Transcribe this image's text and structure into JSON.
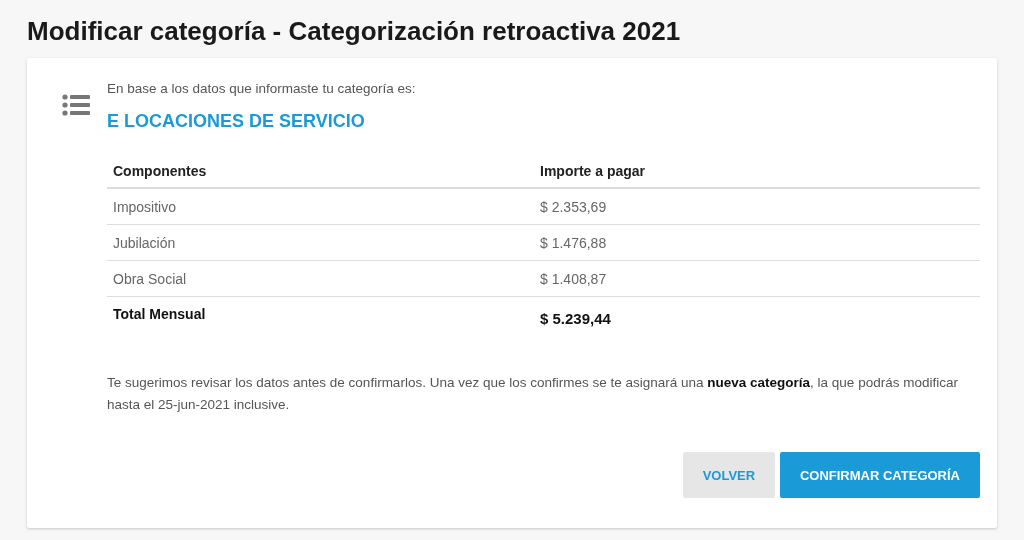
{
  "page": {
    "title": "Modificar categoría - Categorización retroactiva 2021"
  },
  "result": {
    "intro": "En base a los datos que informaste tu categoría es:",
    "category": "E LOCACIONES DE SERVICIO"
  },
  "table": {
    "columns": [
      "Componentes",
      "Importe a pagar"
    ],
    "rows": [
      {
        "kind": "item",
        "cells": [
          "Impositivo",
          "$ 2.353,69"
        ]
      },
      {
        "kind": "item",
        "cells": [
          "Jubilación",
          "$ 1.476,88"
        ]
      },
      {
        "kind": "item",
        "cells": [
          "Obra Social",
          "$ 1.408,87"
        ]
      },
      {
        "kind": "total",
        "cells": [
          "Total Mensual",
          "$ 5.239,44"
        ]
      }
    ]
  },
  "notice": "Te sugerimos revisar los datos antes de confirmarlos. Una vez que los confirmes se te asignará una **nueva categoría**, la que podrás modificar hasta el 25-jun-2021 inclusive.",
  "buttons": [
    {
      "kind": "secondary",
      "label": "VOLVER"
    },
    {
      "kind": "primary",
      "label": "CONFIRMAR CATEGORÍA"
    }
  ]
}
